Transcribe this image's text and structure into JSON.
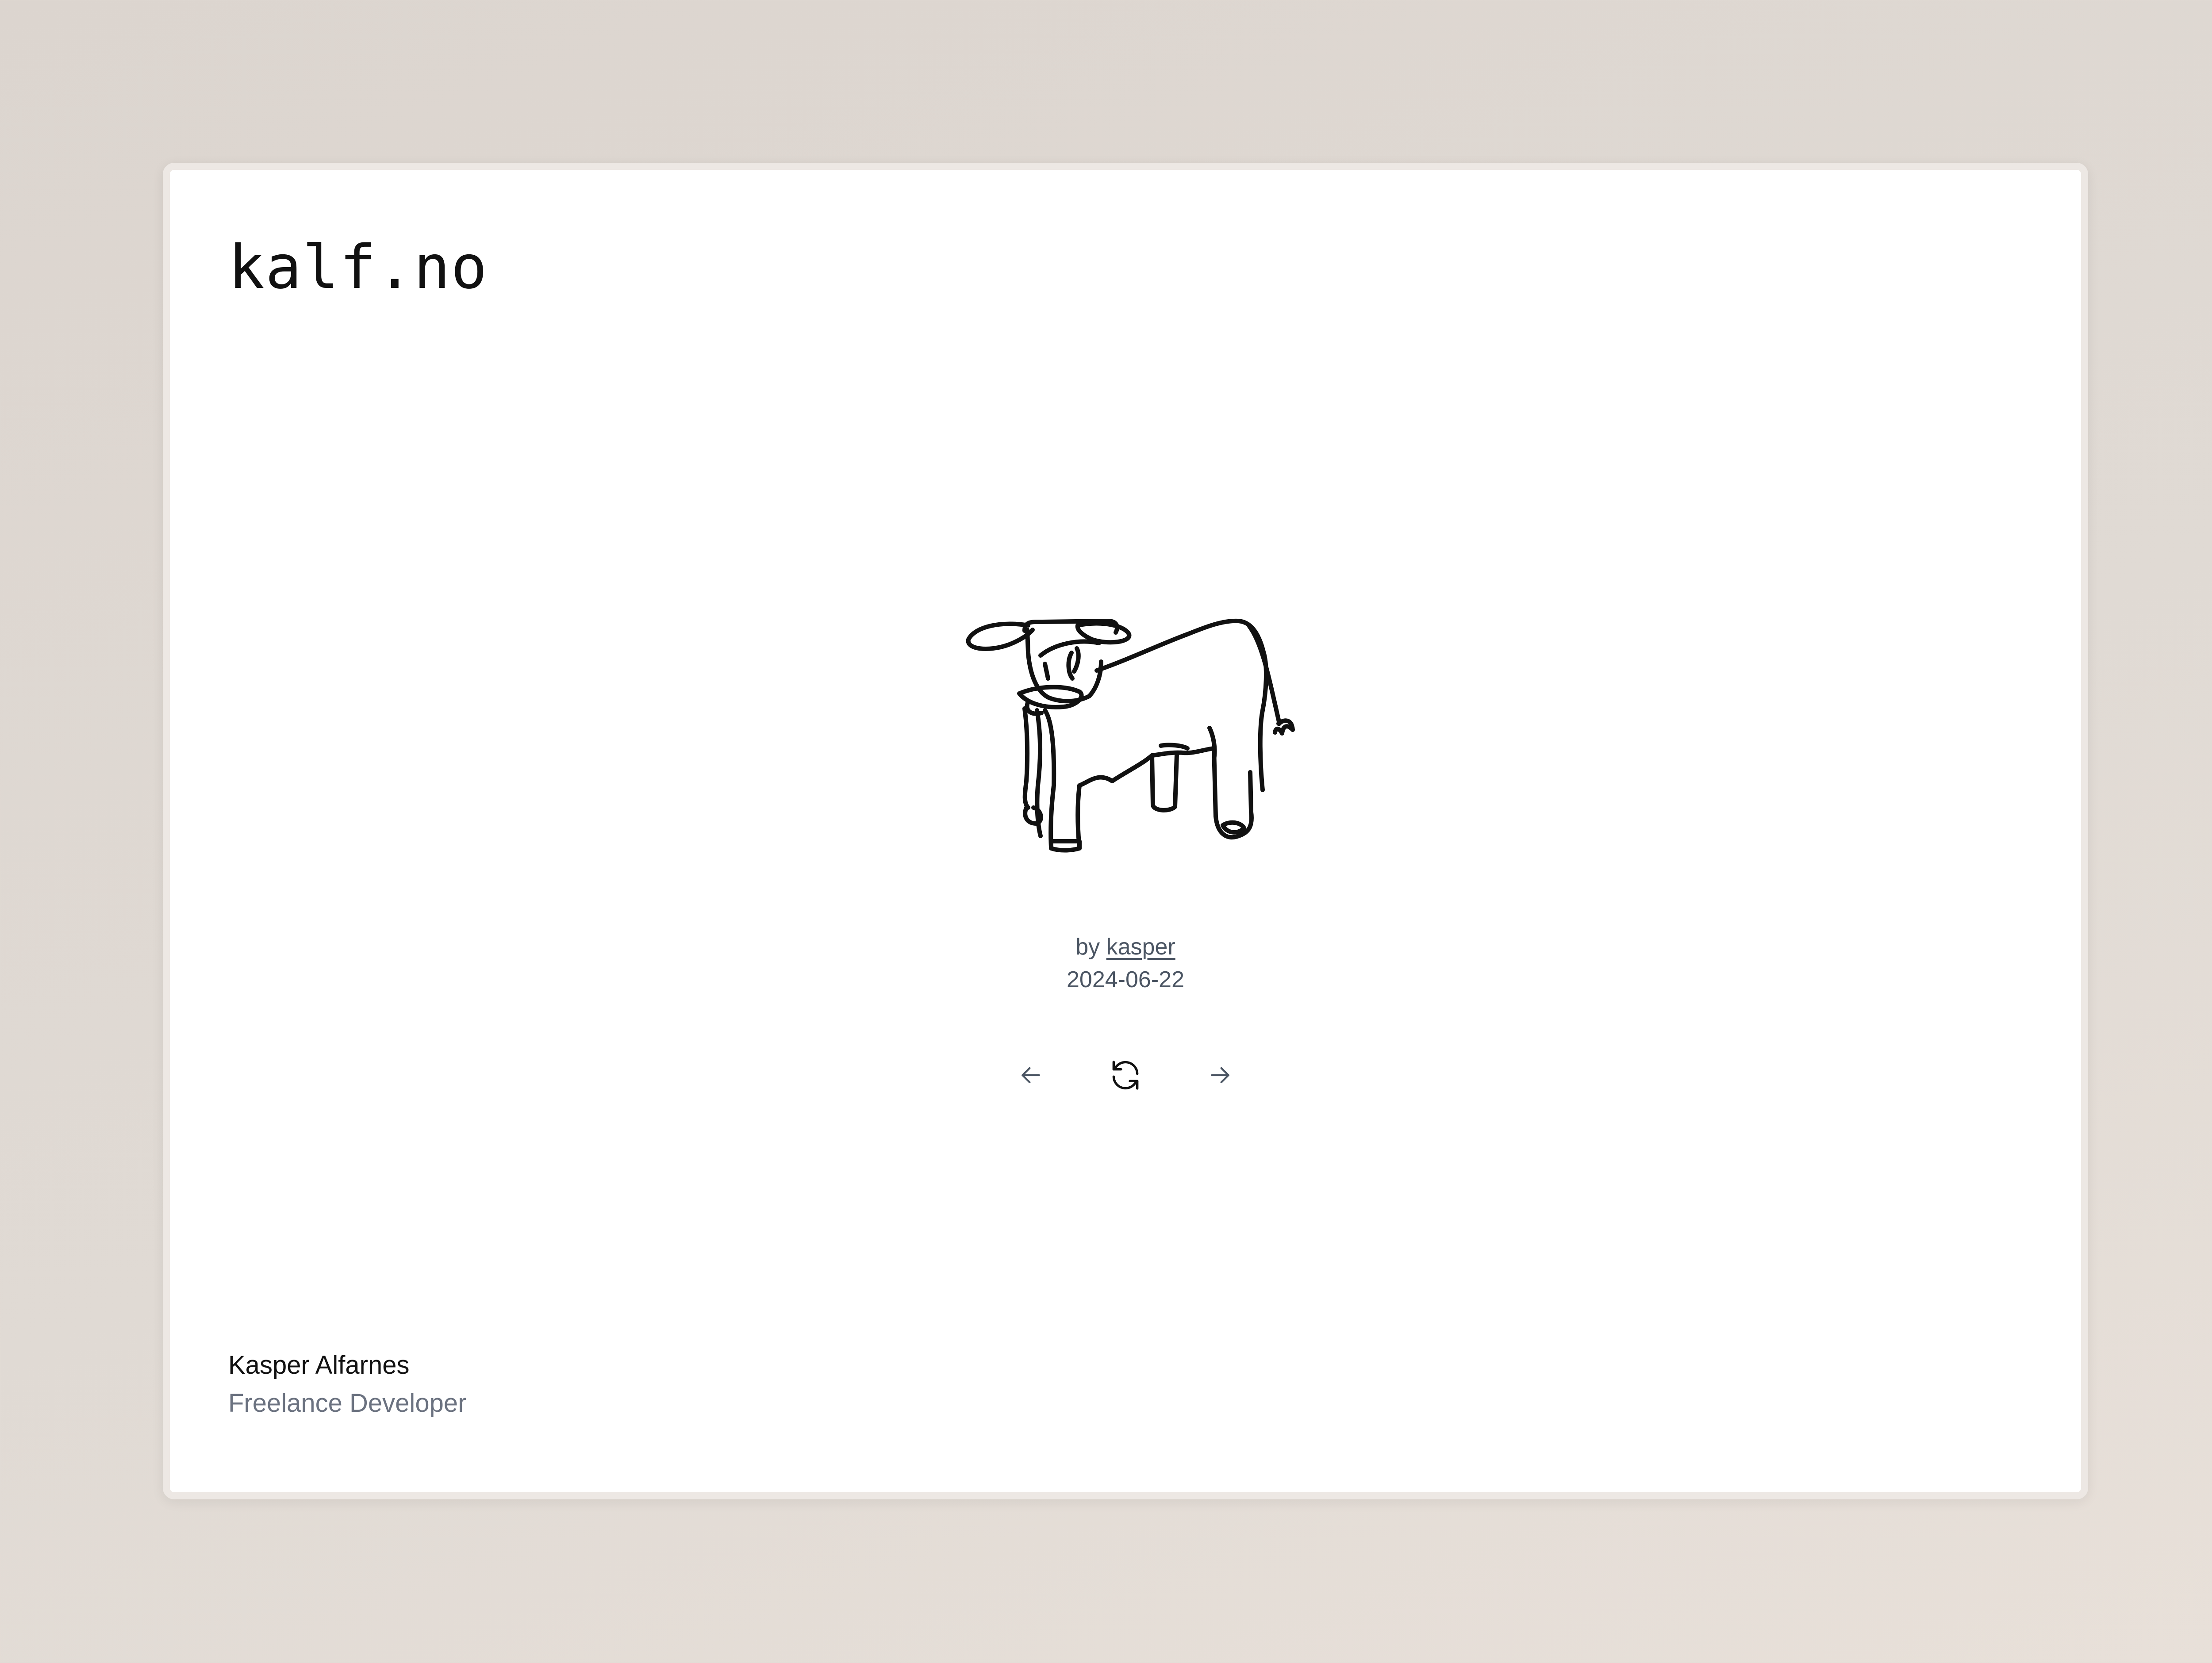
{
  "site": {
    "logo": "kalf.no"
  },
  "drawing": {
    "subject": "calf line drawing",
    "stroke_color": "#111111"
  },
  "credit": {
    "by_prefix": "by",
    "author": "kasper",
    "date": "2024-06-22"
  },
  "controls": {
    "previous_icon": "arrow-left-icon",
    "refresh_icon": "refresh-icon",
    "next_icon": "arrow-right-icon"
  },
  "footer": {
    "name": "Kasper Alfarnes",
    "role": "Freelance Developer"
  },
  "colors": {
    "background": "#dcd5cf",
    "card": "#ffffff",
    "card_border": "#ede8e4",
    "text": "#111111",
    "muted": "#4b5563",
    "subtle": "#6b7280"
  }
}
